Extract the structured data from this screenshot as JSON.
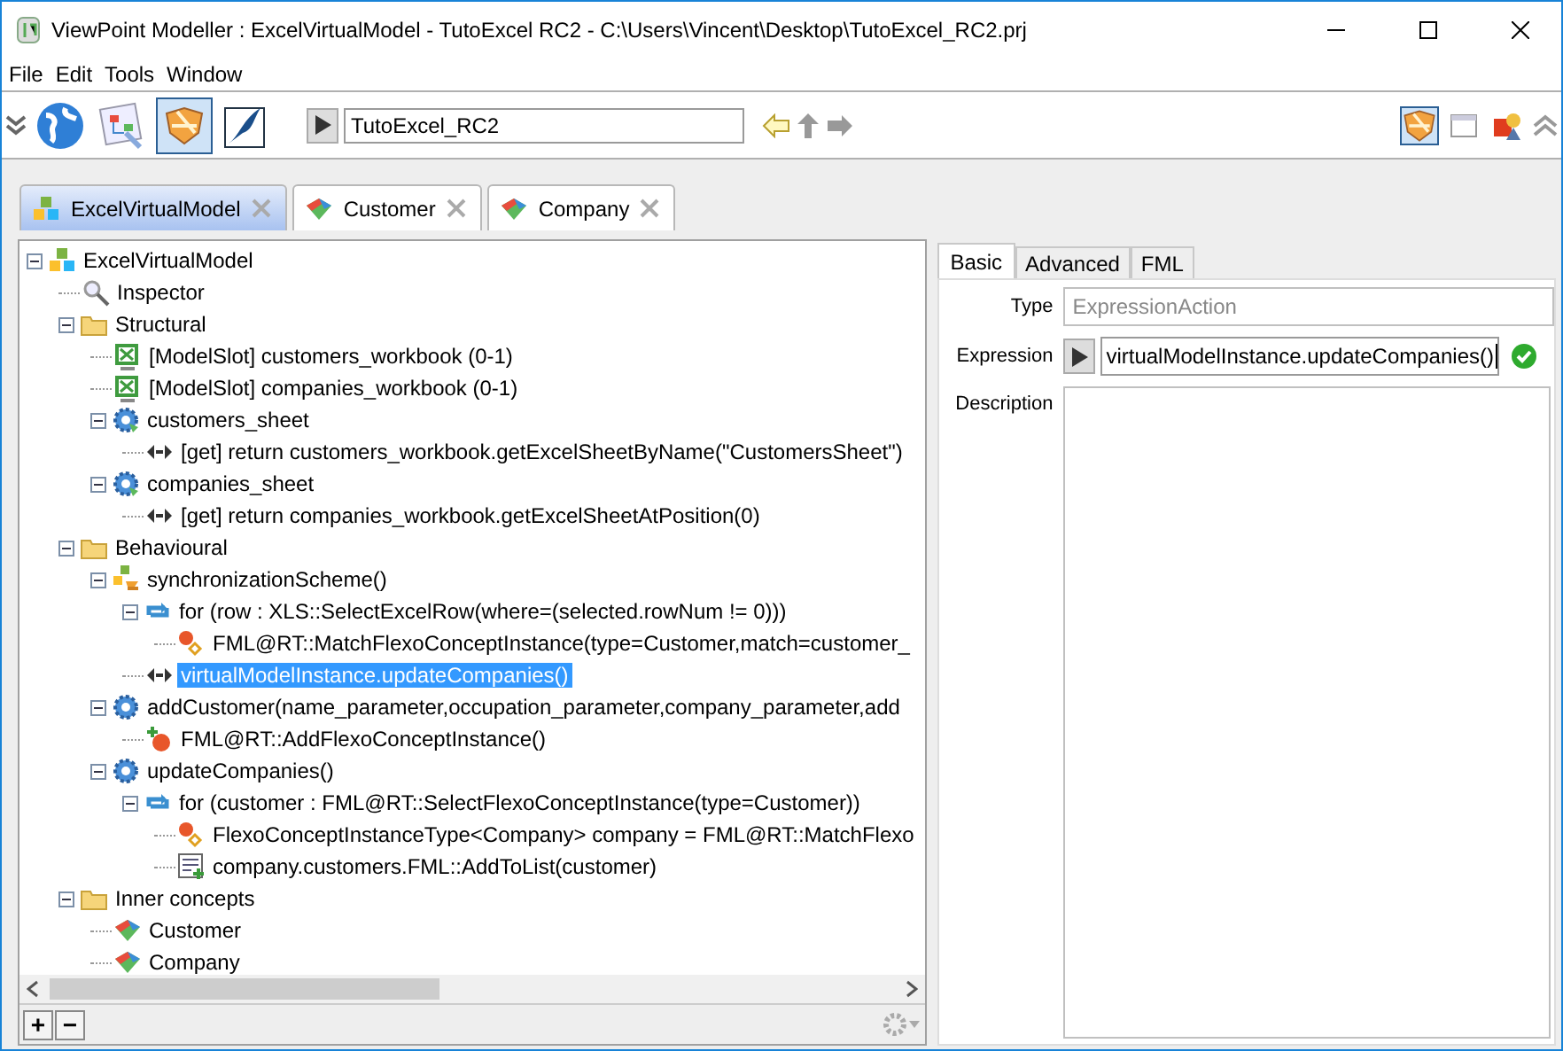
{
  "window": {
    "title": "ViewPoint Modeller : ExcelVirtualModel - TutoExcel RC2 - C:\\Users\\Vincent\\Desktop\\TutoExcel_RC2.prj"
  },
  "menu": [
    "File",
    "Edit",
    "Tools",
    "Window"
  ],
  "toolbar": {
    "tools": [
      {
        "kind": "globe",
        "selected": false
      },
      {
        "kind": "diagram",
        "selected": false
      },
      {
        "kind": "shield",
        "selected": true
      },
      {
        "kind": "bird",
        "selected": false
      }
    ],
    "path": "TutoExcel_RC2",
    "right_tools": [
      {
        "kind": "shield",
        "selected": true
      },
      {
        "kind": "window",
        "selected": false
      },
      {
        "kind": "shapes",
        "selected": false
      }
    ]
  },
  "doc_tabs": [
    {
      "label": "ExcelVirtualModel",
      "kind": "model",
      "selected": true
    },
    {
      "label": "Customer",
      "kind": "concept",
      "selected": false
    },
    {
      "label": "Company",
      "kind": "concept",
      "selected": false
    }
  ],
  "tree": [
    {
      "label": "ExcelVirtualModel",
      "kind": "model",
      "selected": false,
      "expanded": true,
      "children": [
        {
          "label": "Inspector",
          "kind": "inspector",
          "selected": false
        },
        {
          "label": "Structural",
          "kind": "folder",
          "selected": false,
          "expanded": true,
          "children": [
            {
              "label": "[ModelSlot] customers_workbook (0-1)",
              "kind": "slot",
              "selected": false
            },
            {
              "label": "[ModelSlot] companies_workbook (0-1)",
              "kind": "slot",
              "selected": false
            },
            {
              "label": "customers_sheet",
              "kind": "role",
              "selected": false,
              "expanded": true,
              "children": [
                {
                  "label": "[get] return customers_workbook.getExcelSheetByName(\"CustomersSheet\")",
                  "kind": "expr",
                  "selected": false
                }
              ]
            },
            {
              "label": "companies_sheet",
              "kind": "role",
              "selected": false,
              "expanded": true,
              "children": [
                {
                  "label": "[get] return companies_workbook.getExcelSheetAtPosition(0)",
                  "kind": "expr",
                  "selected": false
                }
              ]
            }
          ]
        },
        {
          "label": "Behavioural",
          "kind": "folder",
          "selected": false,
          "expanded": true,
          "children": [
            {
              "label": "synchronizationScheme()",
              "kind": "scheme",
              "selected": false,
              "expanded": true,
              "children": [
                {
                  "label": "for (row : XLS::SelectExcelRow(where=(selected.rowNum != 0)))",
                  "kind": "loop",
                  "selected": false,
                  "expanded": true,
                  "children": [
                    {
                      "label": "FML@RT::MatchFlexoConceptInstance(type=Customer,match=customer_",
                      "kind": "match",
                      "selected": false
                    }
                  ]
                },
                {
                  "label": "virtualModelInstance.updateCompanies()",
                  "kind": "expr",
                  "selected": true
                }
              ]
            },
            {
              "label": "addCustomer(name_parameter,occupation_parameter,company_parameter,add",
              "kind": "behaviour",
              "selected": false,
              "expanded": true,
              "children": [
                {
                  "label": "FML@RT::AddFlexoConceptInstance()",
                  "kind": "add",
                  "selected": false
                }
              ]
            },
            {
              "label": "updateCompanies()",
              "kind": "behaviour",
              "selected": false,
              "expanded": true,
              "children": [
                {
                  "label": "for (customer : FML@RT::SelectFlexoConceptInstance(type=Customer))",
                  "kind": "loop",
                  "selected": false,
                  "expanded": true,
                  "children": [
                    {
                      "label": "FlexoConceptInstanceType<Company> company = FML@RT::MatchFlexo",
                      "kind": "match",
                      "selected": false
                    },
                    {
                      "label": "company.customers.FML::AddToList(customer)",
                      "kind": "list",
                      "selected": false
                    }
                  ]
                }
              ]
            }
          ]
        },
        {
          "label": "Inner concepts",
          "kind": "folder",
          "selected": false,
          "expanded": true,
          "children": [
            {
              "label": "Customer",
              "kind": "concept",
              "selected": false
            },
            {
              "label": "Company",
              "kind": "concept",
              "selected": false
            }
          ]
        }
      ]
    }
  ],
  "tree_buttons": [
    "+",
    "−"
  ],
  "inspector": {
    "tabs": [
      {
        "label": "Basic",
        "selected": true
      },
      {
        "label": "Advanced",
        "selected": false
      },
      {
        "label": "FML",
        "selected": false
      }
    ],
    "type_label": "Type",
    "type_value": "ExpressionAction",
    "expression_label": "Expression",
    "expression_value": "virtualModelInstance.updateCompanies()",
    "expression_valid": true,
    "description_label": "Description"
  }
}
